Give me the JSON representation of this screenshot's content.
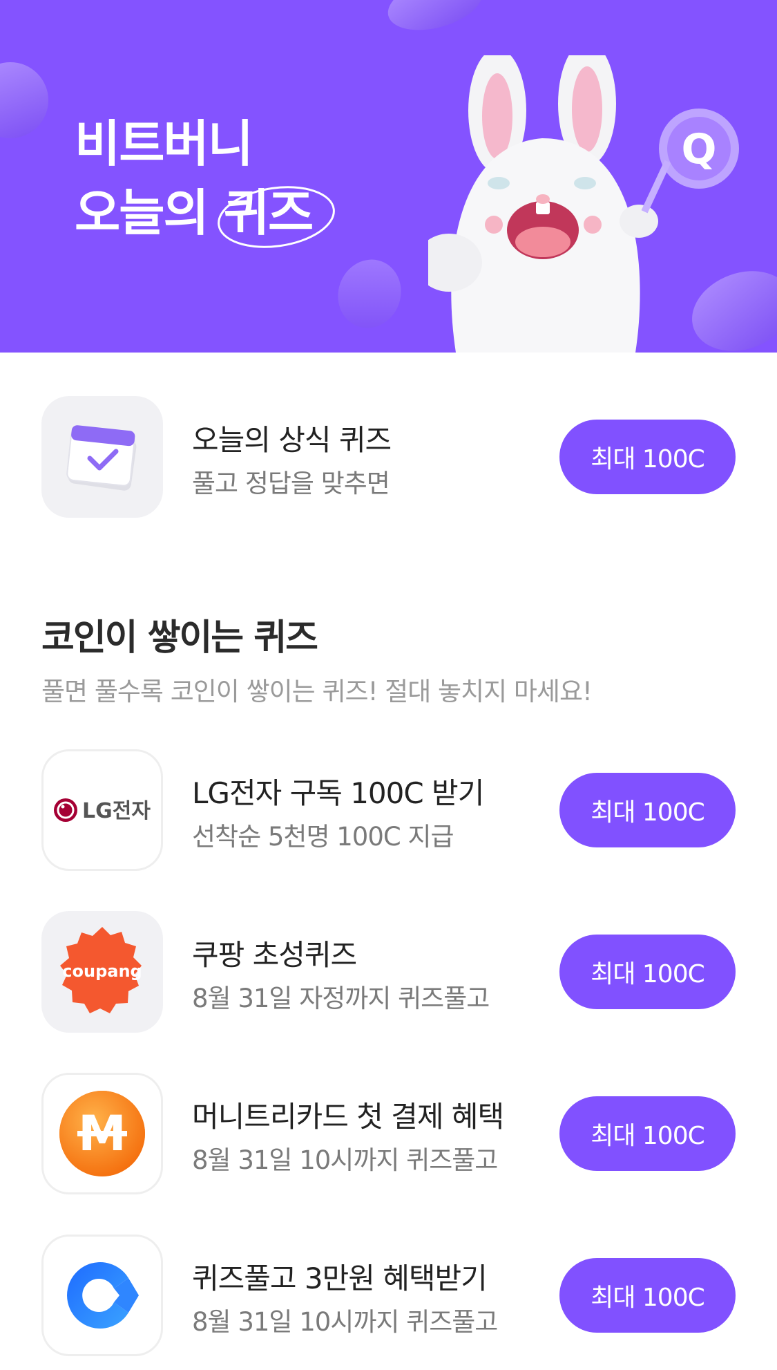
{
  "banner": {
    "title_line1": "비트버니",
    "title_line2_prefix": "오늘의 ",
    "title_line2_circled": "퀴즈",
    "mascot_badge": "Q",
    "background_color": "#8453ff"
  },
  "today_quiz": {
    "icon": "calendar-check-icon",
    "title": "오늘의 상식 퀴즈",
    "subtitle": "풀고 정답을 맞추면",
    "button": "최대 100C"
  },
  "section": {
    "title": "코인이 쌓이는 퀴즈",
    "subtitle": "풀면 풀수록 코인이 쌓이는 퀴즈! 절대 놓치지 마세요!"
  },
  "quizzes": [
    {
      "icon": "lg-electronics-logo",
      "logo_text": "LG전자",
      "title": "LG전자 구독 100C 받기",
      "subtitle": "선착순 5천명 100C 지급",
      "button": "최대 100C"
    },
    {
      "icon": "coupang-logo",
      "logo_text": "coupang",
      "title": "쿠팡 초성퀴즈",
      "subtitle": "8월 31일 자정까지 퀴즈풀고",
      "button": "최대 100C"
    },
    {
      "icon": "moneytree-logo",
      "logo_text": "M",
      "title": "머니트리카드 첫 결제 혜택",
      "subtitle": "8월 31일 10시까지 퀴즈풀고",
      "button": "최대 100C"
    },
    {
      "icon": "c-logo",
      "logo_text": "",
      "title": "퀴즈풀고 3만원 혜택받기",
      "subtitle": "8월 31일 10시까지 퀴즈풀고",
      "button": "최대 100C"
    }
  ],
  "colors": {
    "accent": "#8151ff",
    "text_primary": "#222222",
    "text_secondary": "#7a7a7a"
  }
}
